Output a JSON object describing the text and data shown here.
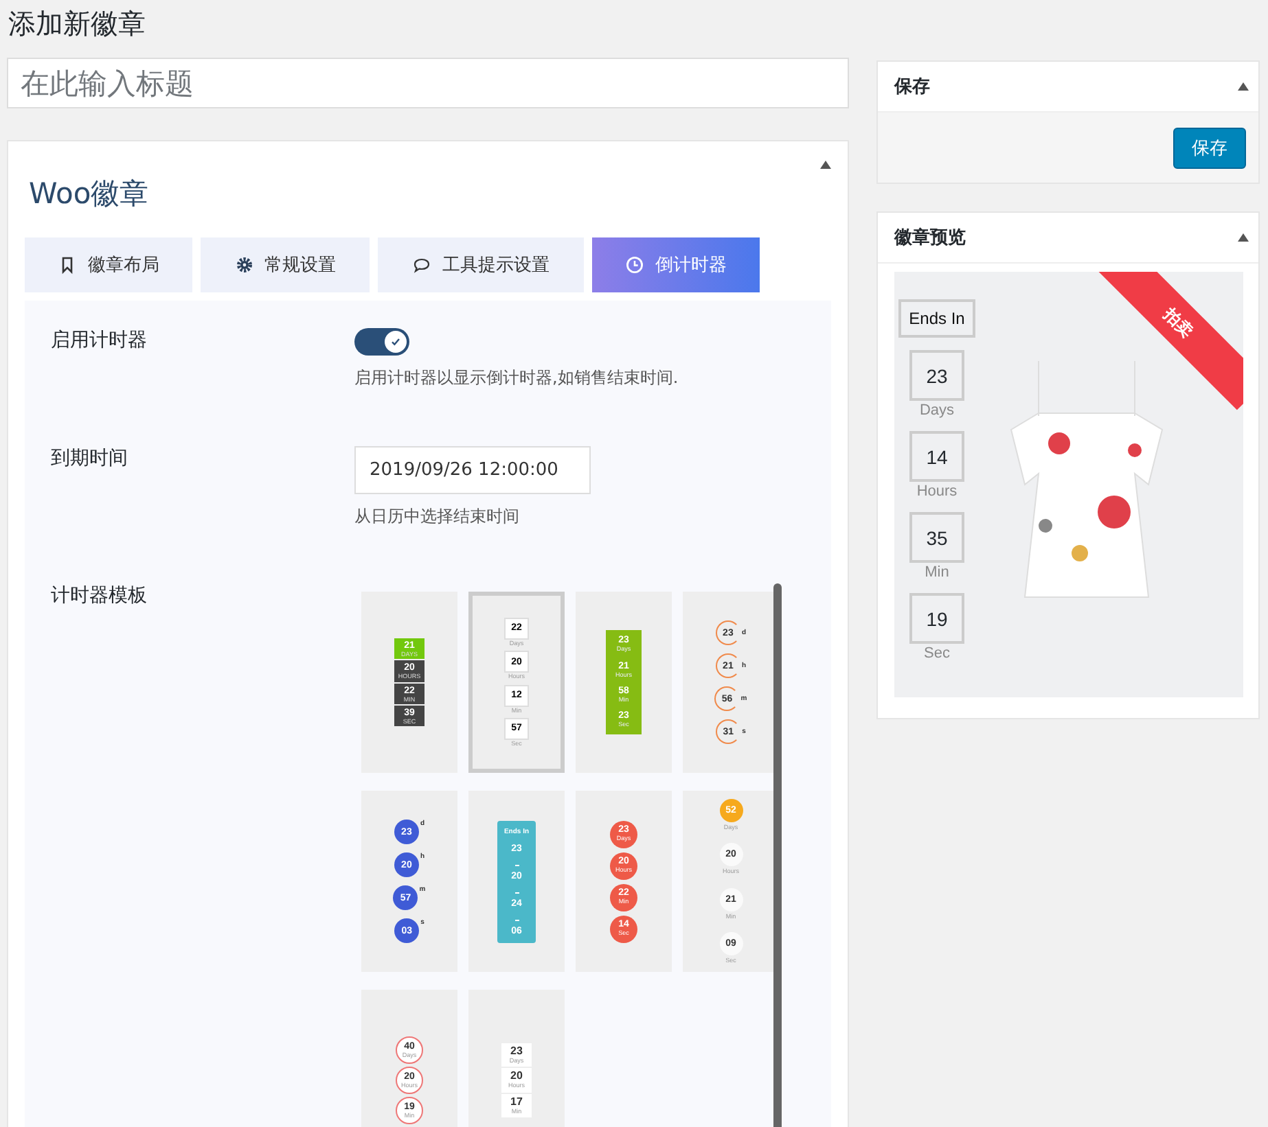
{
  "page_title": "添加新徽章",
  "title_field": {
    "placeholder": "在此输入标题"
  },
  "badge_box": {
    "title": "Woo徽章",
    "tabs": [
      {
        "label": "徽章布局",
        "selected": false
      },
      {
        "label": "常规设置",
        "selected": false
      },
      {
        "label": "工具提示设置",
        "selected": false
      },
      {
        "label": "倒计时器",
        "selected": true
      }
    ],
    "enable_timer": {
      "label": "启用计时器",
      "on": true,
      "hint": "启用计时器以显示倒计时器,如销售结束时间."
    },
    "expiry": {
      "label": "到期时间",
      "value": "2019/09/26 12:00:00",
      "hint": "从日历中选择结束时间"
    },
    "templates_label": "计时器模板",
    "templates": [
      {
        "kind": "blocks",
        "selected": false,
        "units": [
          {
            "value": "21",
            "label": "DAYS"
          },
          {
            "value": "20",
            "label": "HOURS"
          },
          {
            "value": "22",
            "label": "MIN"
          },
          {
            "value": "39",
            "label": "SEC"
          }
        ]
      },
      {
        "kind": "boxes",
        "selected": true,
        "units": [
          {
            "value": "22",
            "label": "Days"
          },
          {
            "value": "20",
            "label": "Hours"
          },
          {
            "value": "12",
            "label": "Min"
          },
          {
            "value": "57",
            "label": "Sec"
          }
        ]
      },
      {
        "kind": "green-bar",
        "selected": false,
        "units": [
          {
            "value": "23",
            "label": "Days"
          },
          {
            "value": "21",
            "label": "Hours"
          },
          {
            "value": "58",
            "label": "Min"
          },
          {
            "value": "23",
            "label": "Sec"
          }
        ]
      },
      {
        "kind": "rings",
        "selected": false,
        "units": [
          {
            "value": "23",
            "label": "d"
          },
          {
            "value": "21",
            "label": "h"
          },
          {
            "value": "56",
            "label": "m"
          },
          {
            "value": "31",
            "label": "s"
          }
        ]
      },
      {
        "kind": "blue-dots",
        "selected": false,
        "units": [
          {
            "value": "23",
            "label": "d"
          },
          {
            "value": "20",
            "label": "h"
          },
          {
            "value": "57",
            "label": "m"
          },
          {
            "value": "03",
            "label": "s"
          }
        ]
      },
      {
        "kind": "teal-card",
        "selected": false,
        "header": "Ends In",
        "units": [
          {
            "value": "23"
          },
          {
            "value": "20"
          },
          {
            "value": "24"
          },
          {
            "value": "06"
          }
        ]
      },
      {
        "kind": "red-dots",
        "selected": false,
        "units": [
          {
            "value": "23",
            "label": "Days"
          },
          {
            "value": "20",
            "label": "Hours"
          },
          {
            "value": "22",
            "label": "Min"
          },
          {
            "value": "14",
            "label": "Sec"
          }
        ]
      },
      {
        "kind": "plain-circles",
        "selected": false,
        "units": [
          {
            "value": "52",
            "label": "Days"
          },
          {
            "value": "20",
            "label": "Hours"
          },
          {
            "value": "21",
            "label": "Min"
          },
          {
            "value": "09",
            "label": "Sec"
          }
        ]
      },
      {
        "kind": "outline-circles",
        "selected": false,
        "units": [
          {
            "value": "40",
            "label": "Days"
          },
          {
            "value": "20",
            "label": "Hours"
          },
          {
            "value": "19",
            "label": "Min"
          }
        ]
      },
      {
        "kind": "white-boxes",
        "selected": false,
        "units": [
          {
            "value": "23",
            "label": "Days"
          },
          {
            "value": "20",
            "label": "Hours"
          },
          {
            "value": "17",
            "label": "Min"
          }
        ]
      }
    ]
  },
  "save_box": {
    "title": "保存",
    "button": "保存"
  },
  "preview_box": {
    "title": "徽章预览",
    "ribbon": "拍卖",
    "header": "Ends In",
    "units": [
      {
        "value": "23",
        "label": "Days"
      },
      {
        "value": "14",
        "label": "Hours"
      },
      {
        "value": "35",
        "label": "Min"
      },
      {
        "value": "19",
        "label": "Sec"
      }
    ]
  }
}
